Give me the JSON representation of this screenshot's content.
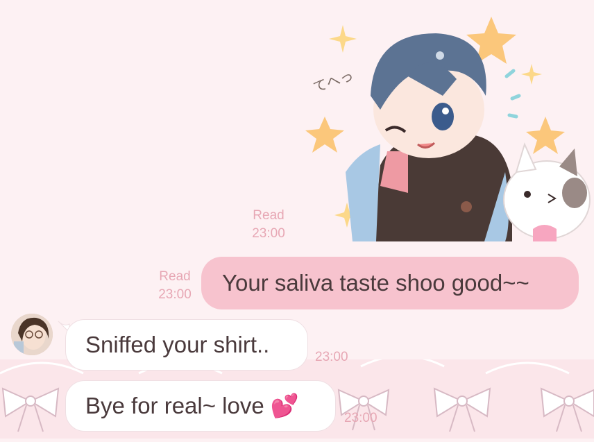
{
  "chat": {
    "messages": [
      {
        "type": "sticker",
        "direction": "outgoing",
        "read": "Read",
        "time": "23:00",
        "sticker_text": "てへっ"
      },
      {
        "type": "text",
        "direction": "outgoing",
        "read": "Read",
        "time": "23:00",
        "text": "Your saliva taste shoo good~~"
      },
      {
        "type": "text",
        "direction": "incoming",
        "time": "23:00",
        "text": "Sniffed your shirt.."
      },
      {
        "type": "text",
        "direction": "incoming",
        "time": "23:00",
        "text": "Bye for real~ love 💕"
      }
    ]
  },
  "colors": {
    "outgoing_bubble": "#f7c3ce",
    "incoming_bubble": "#ffffff",
    "meta_text": "#e7a7b4",
    "background": "#fdf1f3"
  },
  "icons": {
    "background_pattern": "bow-icon",
    "heart": "two-hearts-emoji"
  }
}
